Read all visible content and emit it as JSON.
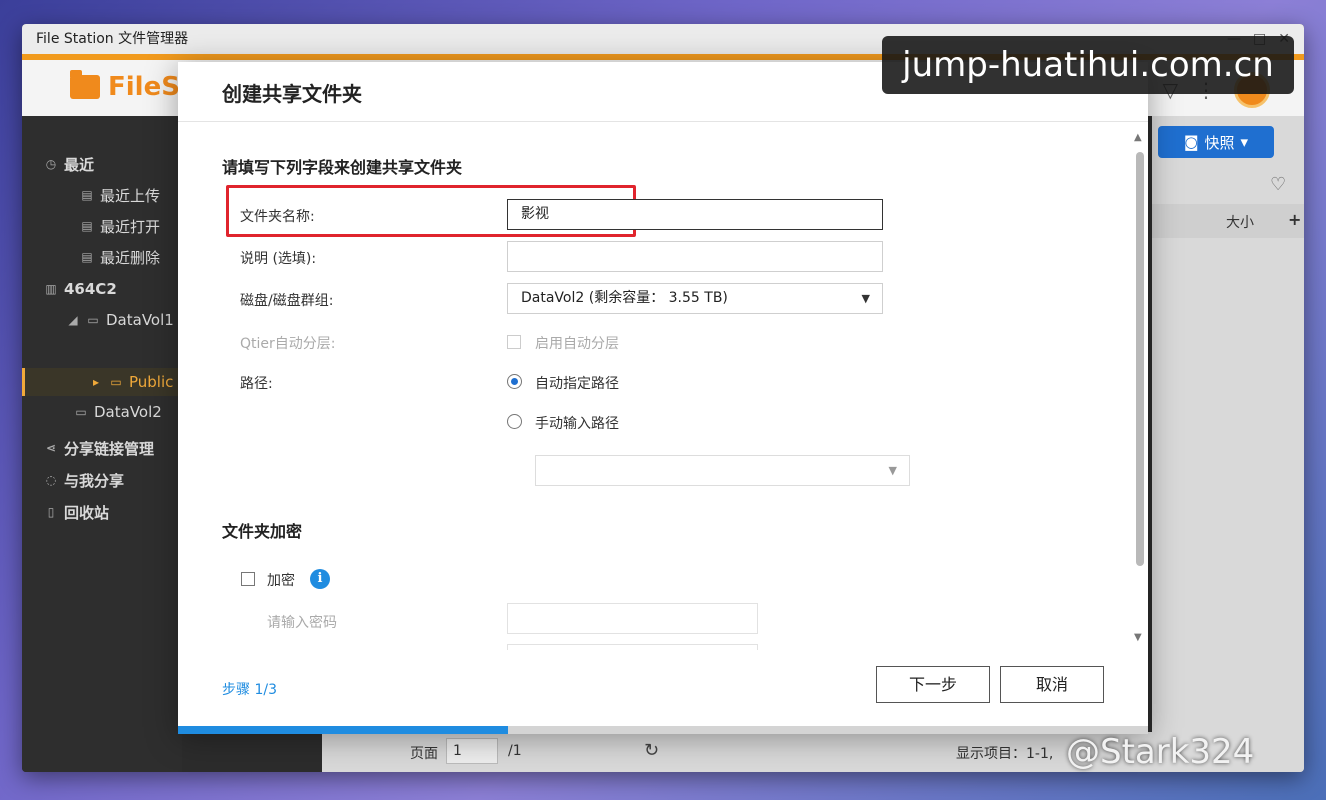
{
  "window": {
    "title": "File Station 文件管理器",
    "controls": [
      "—",
      "□",
      "✕"
    ]
  },
  "app": {
    "logo_text": "FileS"
  },
  "sidebar": {
    "recent": "最近",
    "recent_upload": "最近上传",
    "recent_open": "最近打开",
    "recent_delete": "最近删除",
    "nas": "464C2",
    "vol1": "DataVol1",
    "public": "Public",
    "vol2": "DataVol2",
    "share_link": "分享链接管理",
    "shared_with_me": "与我分享",
    "recycle": "回收站"
  },
  "right_pane": {
    "snapshot_btn": "快照",
    "size_col": "大小"
  },
  "bottom_bar": {
    "page_label": "页面",
    "page_value": "1",
    "page_total": "/1",
    "display_items": "显示项目：1-1,"
  },
  "dialog": {
    "title": "创建共享文件夹",
    "section_fields": "请填写下列字段来创建共享文件夹",
    "folder_name_label": "文件夹名称:",
    "folder_name_value": "影视",
    "desc_label": "说明 (选填):",
    "desc_value": "",
    "disk_label": "磁盘/磁盘群组:",
    "disk_value": "DataVol2 (剩余容量： 3.55 TB)",
    "qtier_label": "Qtier自动分层:",
    "qtier_option": "启用自动分层",
    "path_label": "路径:",
    "path_auto": "自动指定路径",
    "path_manual": "手动输入路径",
    "section_encrypt": "文件夹加密",
    "encrypt_label": "加密",
    "password_label": "请输入密码",
    "step": "步骤 1/3",
    "next_button": "下一步",
    "cancel_button": "取消",
    "progress_fraction": 0.34
  },
  "watermarks": {
    "top": "jump-huatihui.com.cn",
    "bottom": "@Stark324"
  },
  "colors": {
    "accent_blue": "#1f8ce0",
    "brand_orange": "#f19a1d",
    "highlight_red": "#e0242d"
  }
}
